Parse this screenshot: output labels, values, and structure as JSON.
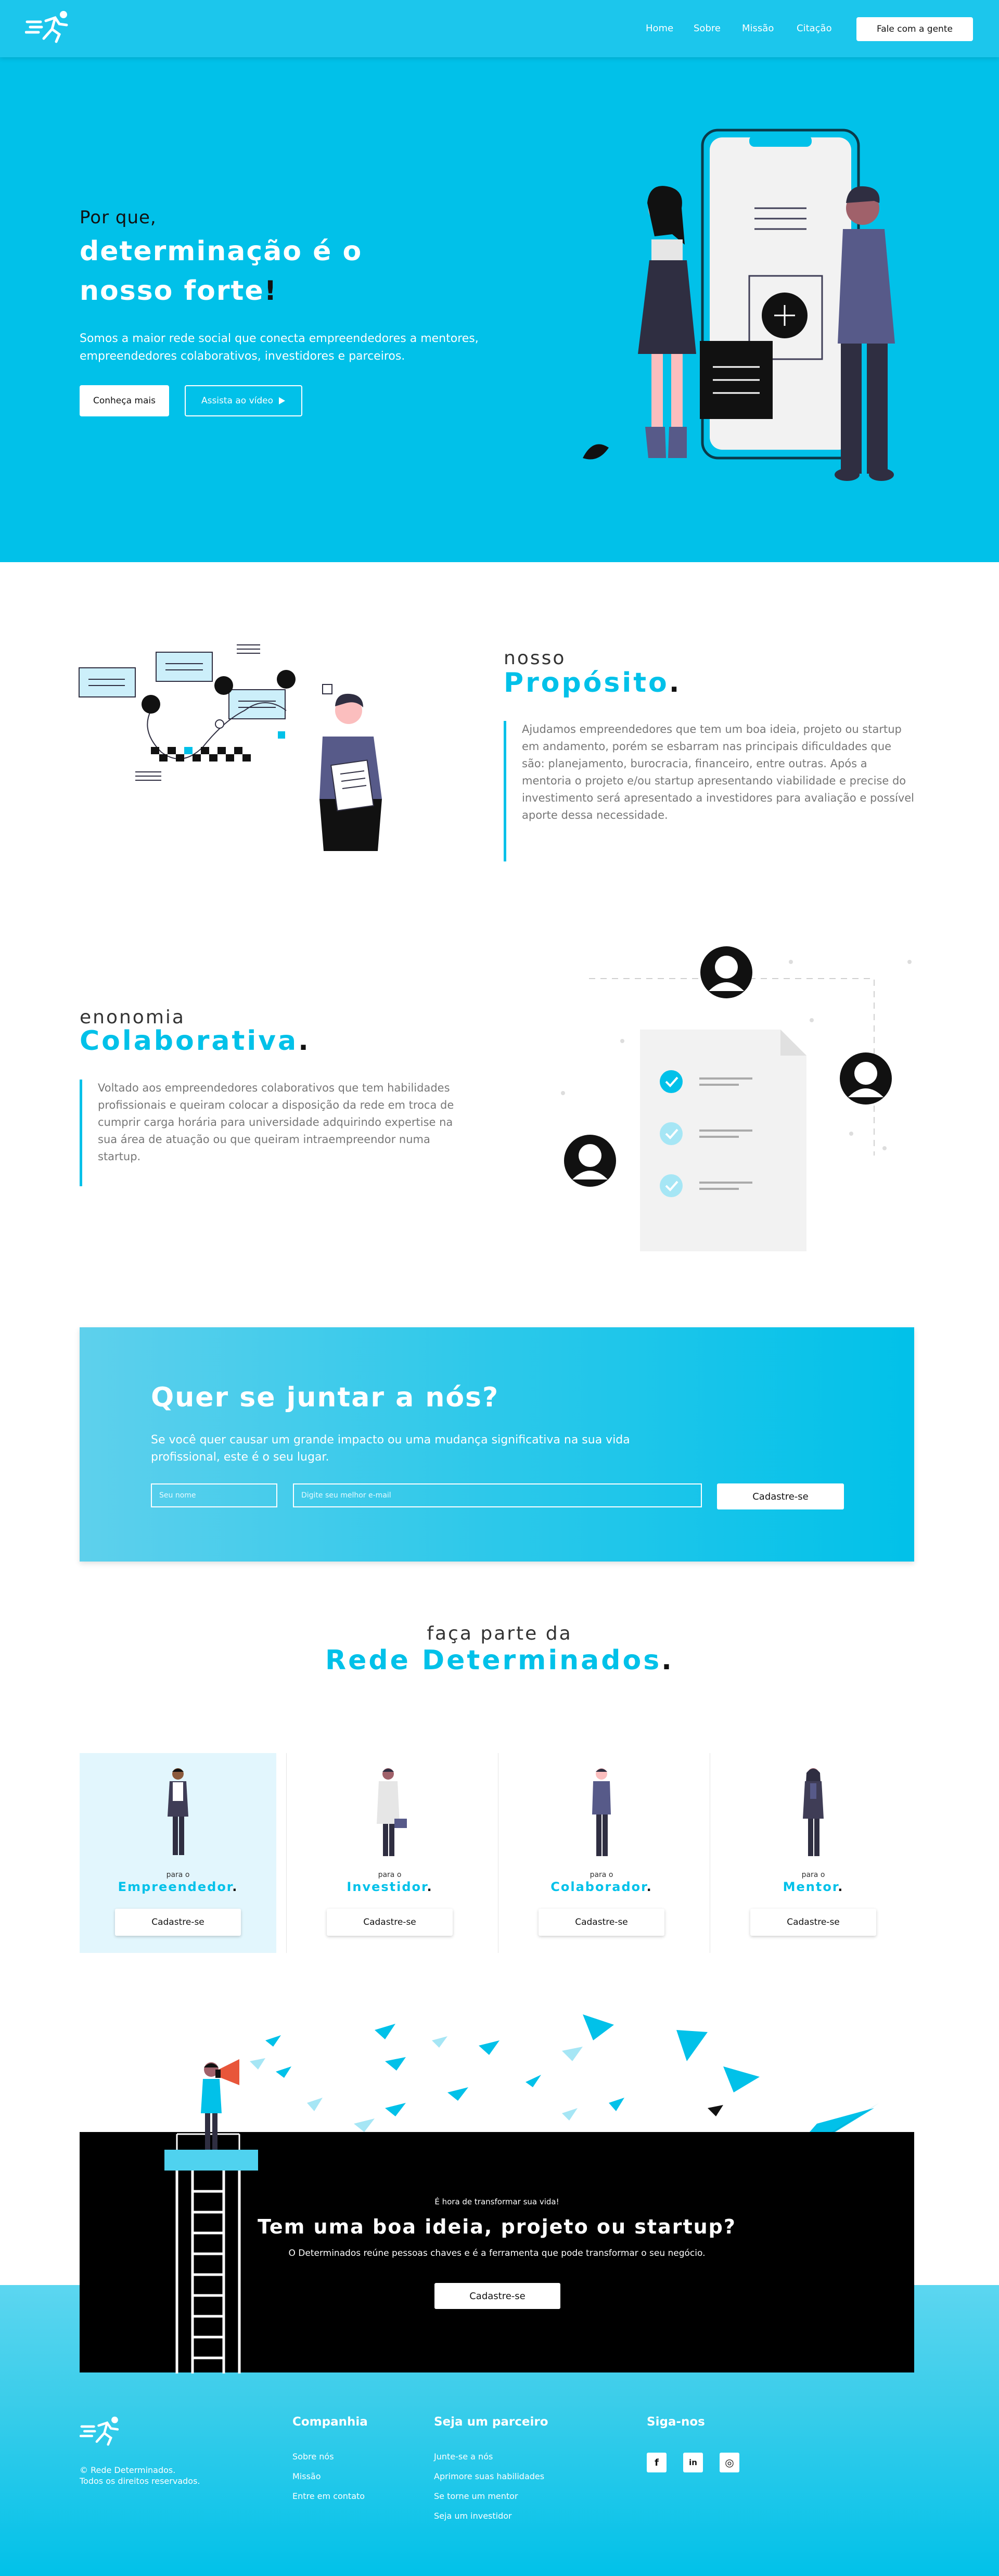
{
  "nav": {
    "links": [
      "Home",
      "Sobre",
      "Missão",
      "Citação"
    ],
    "cta": "Fale com a gente"
  },
  "hero": {
    "pre": "Por que,",
    "title_line1": "determinação é o",
    "title_line2": "nosso forte",
    "title_bang": "!",
    "subtitle": "Somos a maior rede social que conecta empreendedores a mentores, empreendedores colaborativos, investidores e parceiros.",
    "btn_more": "Conheça mais",
    "btn_video": "Assista ao vídeo"
  },
  "purpose": {
    "pre": "nosso",
    "title": "Propósito",
    "dot": ".",
    "text": "Ajudamos empreendedores que tem um boa ideia, projeto ou startup em andamento, porém se esbarram nas principais dificuldades que são: planejamento, burocracia, financeiro, entre outras. Após a mentoria o projeto e/ou startup apresentando viabilidade e precise do investimento será apresentado a investidores para avaliação e possível aporte dessa necessidade."
  },
  "collab": {
    "pre": "enonomia",
    "title": "Colaborativa",
    "dot": ".",
    "text": "Voltado aos empreendedores colaborativos que tem habilidades profissionais e queiram colocar a disposição da rede em troca de cumprir carga horária para universidade adquirindo expertise na sua área de atuação ou que queiram  intraempreendor numa startup."
  },
  "join": {
    "title": "Quer se juntar a nós?",
    "text": "Se você quer causar um grande impacto ou uma mudança significativa na sua vida profissional, este é o seu lugar.",
    "name_placeholder": "Seu nome",
    "email_placeholder": "Digite seu melhor e-mail",
    "button": "Cadastre-se"
  },
  "network": {
    "pre": "faça parte da",
    "title": "Rede Determinados",
    "dot": ".",
    "cards": [
      {
        "pre": "para o",
        "title": "Empreendedor",
        "dot": ".",
        "button": "Cadastre-se"
      },
      {
        "pre": "para o",
        "title": "Investidor",
        "dot": ".",
        "button": "Cadastre-se"
      },
      {
        "pre": "para o",
        "title": "Colaborador",
        "dot": ".",
        "button": "Cadastre-se"
      },
      {
        "pre": "para o",
        "title": "Mentor",
        "dot": ".",
        "button": "Cadastre-se"
      }
    ]
  },
  "cta": {
    "small": "É hora de transformar sua vida!",
    "title": "Tem uma boa ideia, projeto ou startup?",
    "sub": "O Determinados reúne pessoas chaves e é a ferramenta que pode transformar o seu negócio.",
    "button": "Cadastre-se"
  },
  "footer": {
    "copy_line1": "© Rede Determinados.",
    "copy_line2": "Todos os direitos reservados.",
    "company_head": "Companhia",
    "company_links": [
      "Sobre nós",
      "Missão",
      "Entre em contato"
    ],
    "partner_head": "Seja um parceiro",
    "partner_links": [
      "Junte-se a nós",
      "Aprimore suas habilidades",
      "Se torne um mentor",
      "Seja um investidor"
    ],
    "follow_head": "Siga-nos",
    "social": [
      "f",
      "in",
      "◎"
    ]
  },
  "colors": {
    "accent": "#01c1e9",
    "dark": "#111111"
  },
  "icons": [
    "logo-runner-icon",
    "play-icon",
    "check-icon",
    "user-avatar-icon",
    "paper-plane-icon",
    "megaphone-icon",
    "facebook-icon",
    "linkedin-icon",
    "instagram-icon"
  ]
}
